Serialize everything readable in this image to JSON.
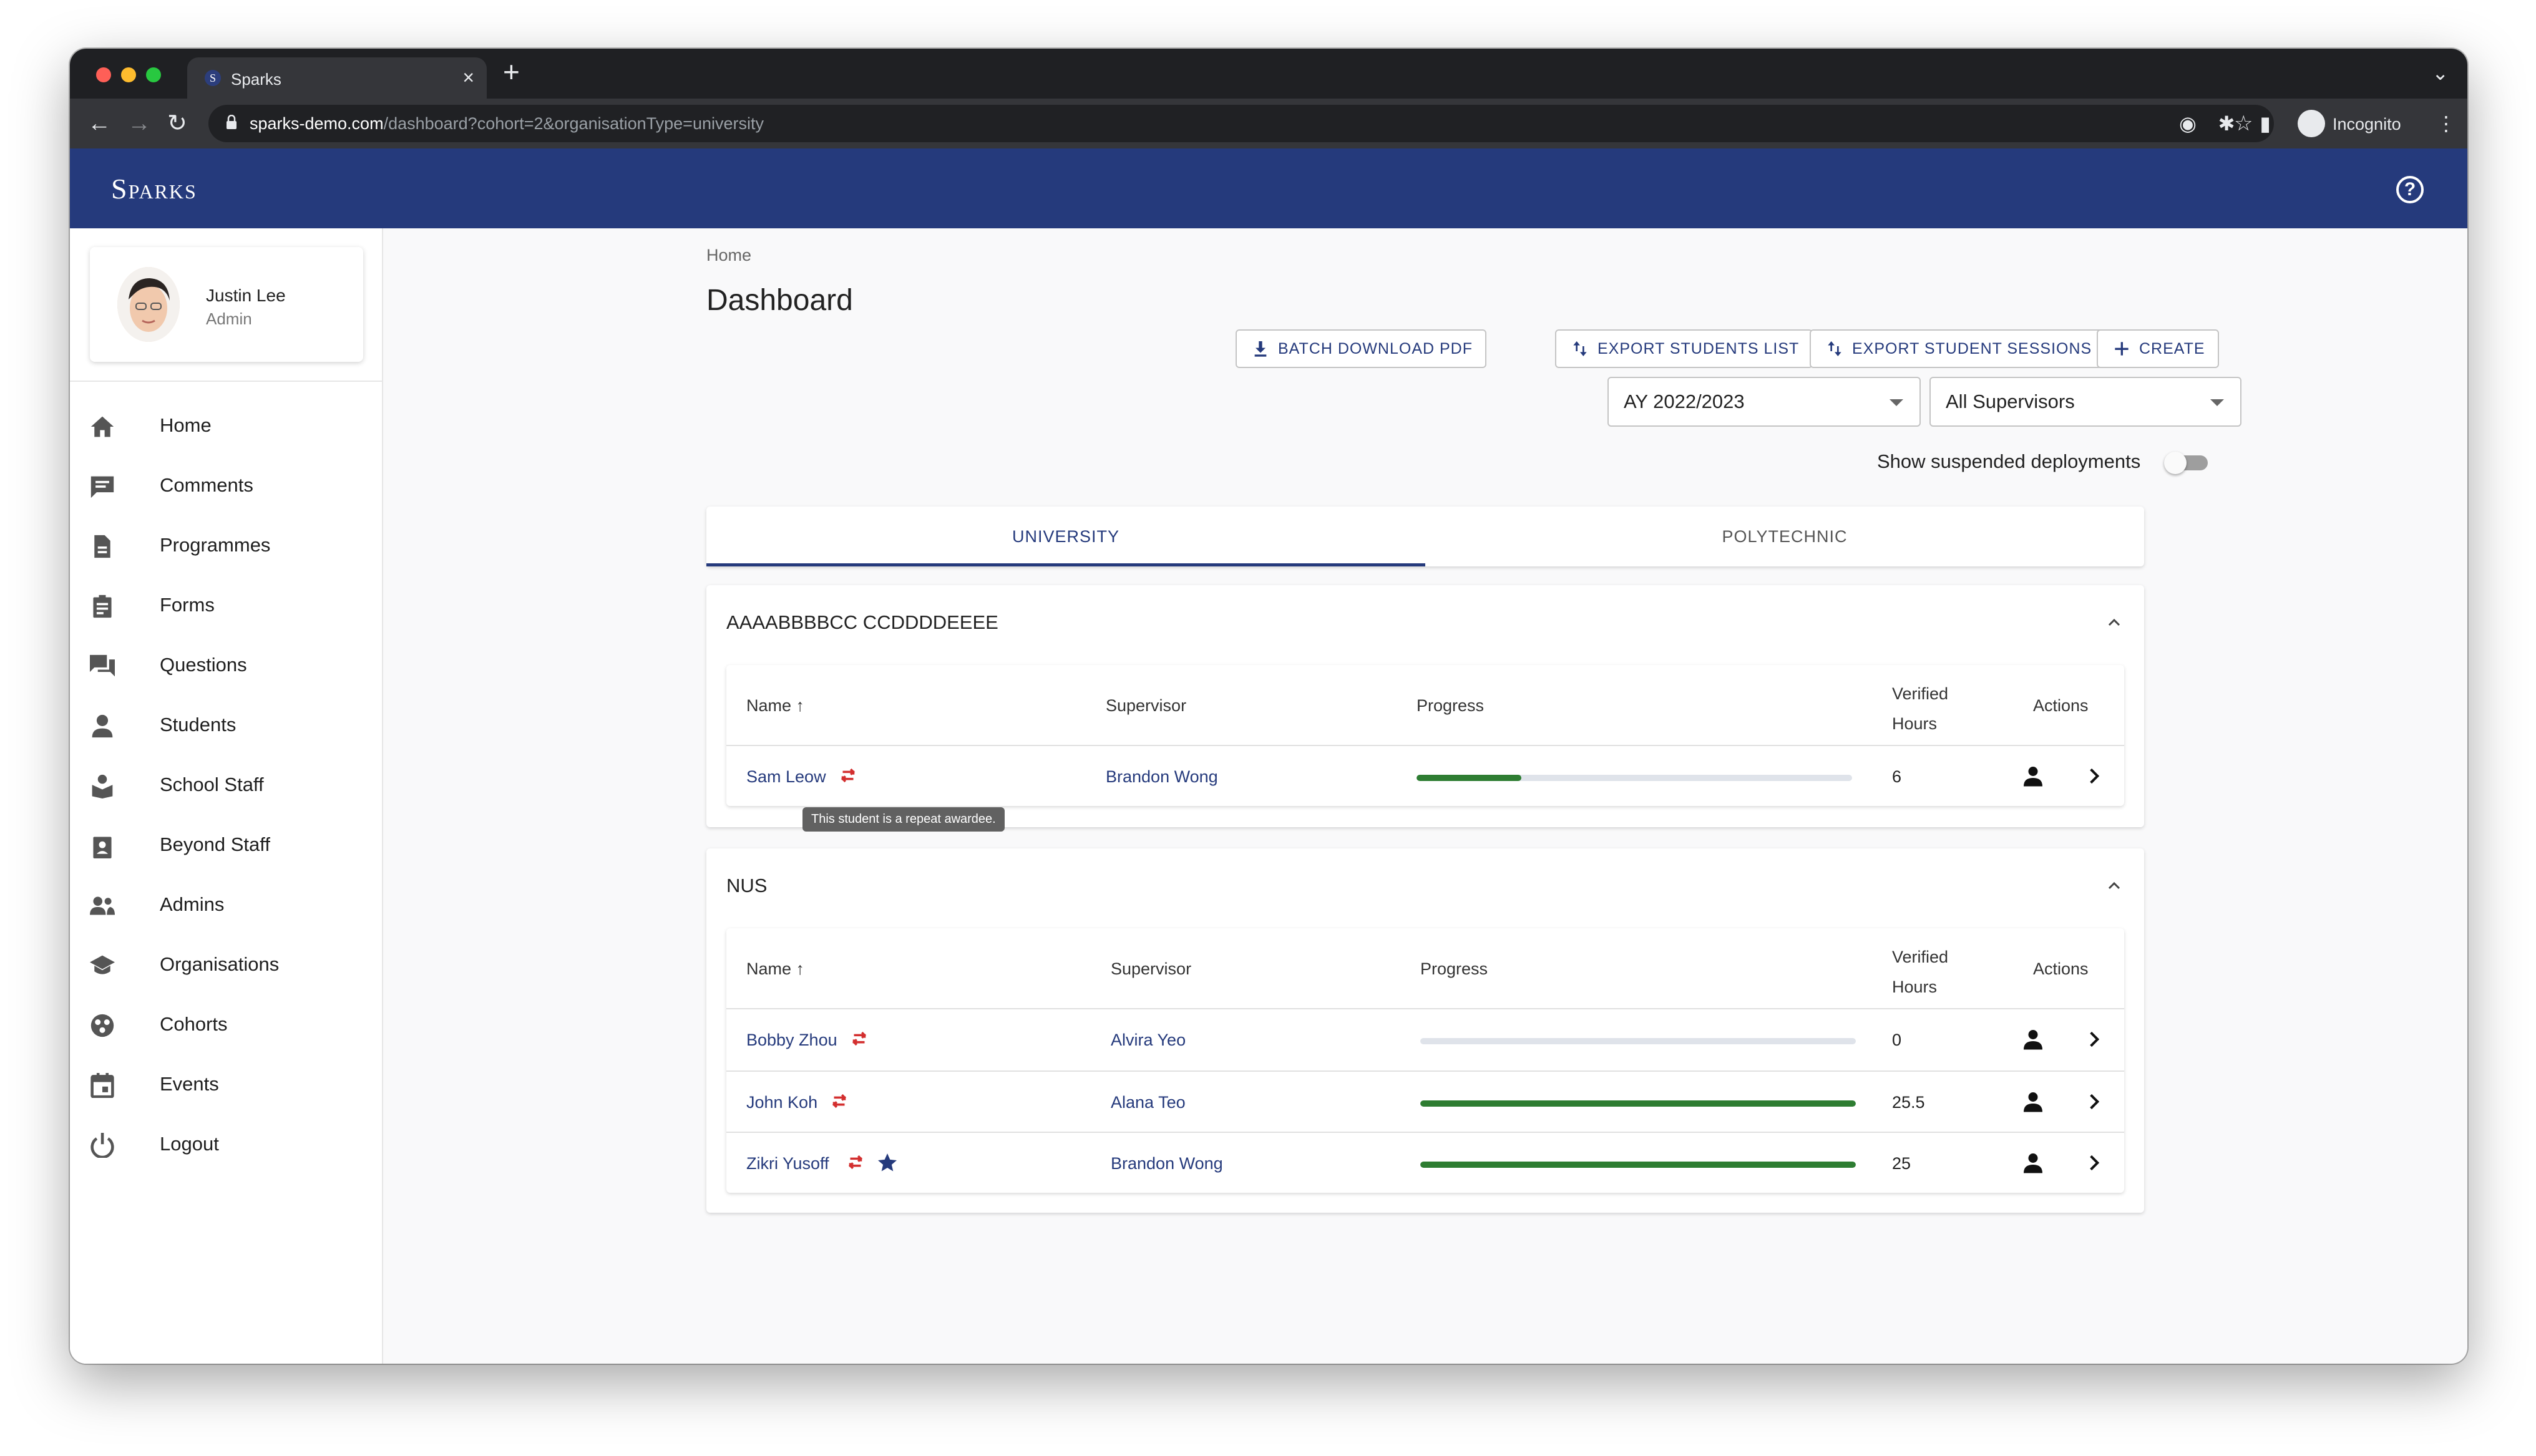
{
  "browser": {
    "tab_title": "Sparks",
    "tab_favicon": "S",
    "url_host": "sparks-demo.com",
    "url_path": "/dashboard?cohort=2&organisationType=university",
    "profile_label": "Incognito"
  },
  "app": {
    "logo": "Sparks",
    "brand_color": "#253a7c"
  },
  "user": {
    "name": "Justin Lee",
    "role": "Admin"
  },
  "sidebar": {
    "items": [
      {
        "label": "Home",
        "icon": "home-icon"
      },
      {
        "label": "Comments",
        "icon": "comment-icon"
      },
      {
        "label": "Programmes",
        "icon": "document-icon"
      },
      {
        "label": "Forms",
        "icon": "clipboard-icon"
      },
      {
        "label": "Questions",
        "icon": "forum-icon"
      },
      {
        "label": "Students",
        "icon": "person-icon"
      },
      {
        "label": "School Staff",
        "icon": "school-staff-icon"
      },
      {
        "label": "Beyond Staff",
        "icon": "badge-icon"
      },
      {
        "label": "Admins",
        "icon": "people-icon"
      },
      {
        "label": "Organisations",
        "icon": "graduation-cap-icon"
      },
      {
        "label": "Cohorts",
        "icon": "cohorts-icon"
      },
      {
        "label": "Events",
        "icon": "calendar-icon"
      },
      {
        "label": "Logout",
        "icon": "power-icon"
      }
    ]
  },
  "page": {
    "breadcrumb": "Home",
    "title": "Dashboard",
    "actions": {
      "batch_download": "BATCH DOWNLOAD PDF",
      "export_students": "EXPORT STUDENTS LIST",
      "export_sessions": "EXPORT STUDENT SESSIONS",
      "create": "CREATE"
    },
    "filters": {
      "year": "AY 2022/2023",
      "supervisor": "All Supervisors"
    },
    "toggle_label": "Show suspended deployments",
    "toggle_on": false
  },
  "tabs": [
    {
      "label": "UNIVERSITY",
      "active": true
    },
    {
      "label": "POLYTECHNIC",
      "active": false
    }
  ],
  "columns": {
    "name": "Name",
    "supervisor": "Supervisor",
    "progress": "Progress",
    "verified_1": "Verified",
    "verified_2": "Hours",
    "actions": "Actions"
  },
  "groups": [
    {
      "name": "AAAABBBBCC CCDDDDEEEE",
      "rows": [
        {
          "name": "Sam Leow",
          "supervisor": "Brandon Wong",
          "progress": 0.24,
          "hours": "6",
          "repeat": true,
          "star": false
        }
      ]
    },
    {
      "name": "NUS",
      "rows": [
        {
          "name": "Bobby Zhou",
          "supervisor": "Alvira Yeo",
          "progress": 0,
          "hours": "0",
          "repeat": true,
          "star": false
        },
        {
          "name": "John Koh",
          "supervisor": "Alana Teo",
          "progress": 1.0,
          "hours": "25.5",
          "repeat": true,
          "star": false
        },
        {
          "name": "Zikri Yusoff",
          "supervisor": "Brandon Wong",
          "progress": 1.0,
          "hours": "25",
          "repeat": true,
          "star": true
        }
      ]
    }
  ],
  "tooltip": "This student is a repeat awardee.",
  "colors": {
    "progress_fill": "#2e7d32",
    "repeat_icon": "#d32f2f",
    "link": "#253a7c"
  }
}
